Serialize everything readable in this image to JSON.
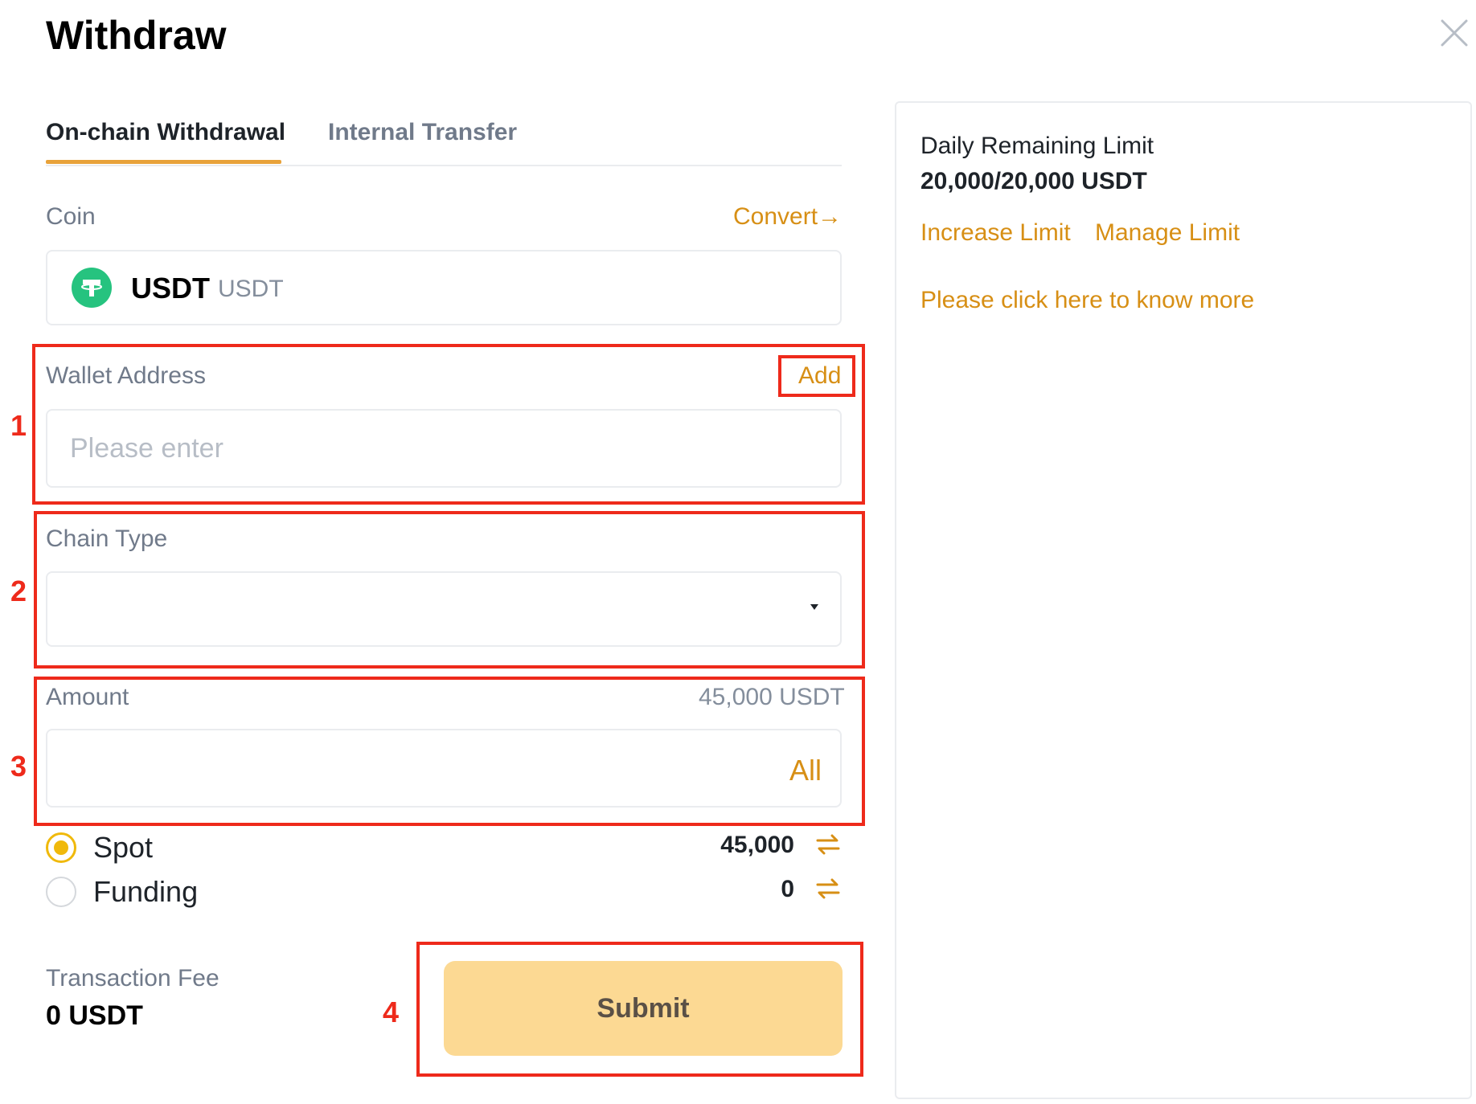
{
  "header": {
    "title": "Withdraw"
  },
  "tabs": [
    {
      "label": "On-chain Withdrawal",
      "active": true
    },
    {
      "label": "Internal Transfer",
      "active": false
    }
  ],
  "coin": {
    "label": "Coin",
    "convert_label": "Convert→",
    "selected_name": "USDT",
    "selected_sub": "USDT",
    "icon": "tether-icon",
    "icon_color": "#26c37f"
  },
  "wallet": {
    "label": "Wallet Address",
    "add_label": "Add",
    "placeholder": "Please enter",
    "value": ""
  },
  "chain": {
    "label": "Chain Type",
    "value": ""
  },
  "amount": {
    "label": "Amount",
    "available": "45,000 USDT",
    "all_label": "All",
    "value": ""
  },
  "accounts": [
    {
      "label": "Spot",
      "value": "45,000",
      "selected": true
    },
    {
      "label": "Funding",
      "value": "0",
      "selected": false
    }
  ],
  "fee": {
    "label": "Transaction Fee",
    "value": "0 USDT"
  },
  "submit_label": "Submit",
  "annotations": [
    "1",
    "2",
    "3",
    "4"
  ],
  "side": {
    "limit_label": "Daily Remaining Limit",
    "limit_value": "20,000/20,000 USDT",
    "increase_label": "Increase Limit",
    "manage_label": "Manage Limit",
    "more_label": "Please click here to know more"
  },
  "colors": {
    "accent": "#f0b90b",
    "link": "#d78f15",
    "annotation": "#ee2a1b",
    "submit_bg": "#fcd993"
  }
}
